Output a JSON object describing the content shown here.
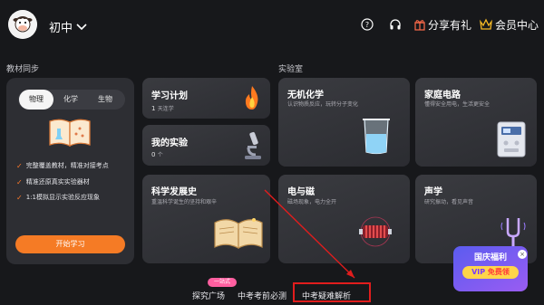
{
  "header": {
    "grade": "初中",
    "share_label": "分享有礼",
    "vip_label": "会员中心"
  },
  "sections": {
    "textbook": "教材同步",
    "lab": "实验室"
  },
  "left_panel": {
    "tabs": [
      {
        "label": "物理",
        "active": true
      },
      {
        "label": "化学",
        "active": false
      },
      {
        "label": "生物",
        "active": false
      }
    ],
    "features": [
      "完整覆盖教材，精准对接考点",
      "精准还原真实实验器材",
      "1:1模拟显示实验反应现象"
    ],
    "start_button": "开始学习"
  },
  "cards": {
    "study_plan": {
      "title": "学习计划",
      "count": "1",
      "unit": "天连学"
    },
    "my_experiments": {
      "title": "我的实验",
      "count": "0",
      "unit": "个"
    },
    "history": {
      "title": "科学发展史",
      "subtitle": "重温科学诞生的坚持和艰辛"
    },
    "inorganic": {
      "title": "无机化学",
      "subtitle": "认识物质反应，玩转分子变化"
    },
    "circuit": {
      "title": "家庭电路",
      "subtitle": "懂得安全用电，生活更安全"
    },
    "electromagnet": {
      "title": "电与磁",
      "subtitle": "磁场现象，电力全开"
    },
    "acoustics": {
      "title": "声学",
      "subtitle": "研究振动，看见声音"
    }
  },
  "bottom_nav": {
    "badge": "一站式",
    "items": [
      "探究广场",
      "中考考前必测",
      "中考疑难解析"
    ]
  },
  "promo": {
    "line1": "国庆福利",
    "line2": "VIP",
    "line3": "免费领"
  },
  "colors": {
    "accent": "#f57b25",
    "highlight_box": "#e11d1d"
  }
}
